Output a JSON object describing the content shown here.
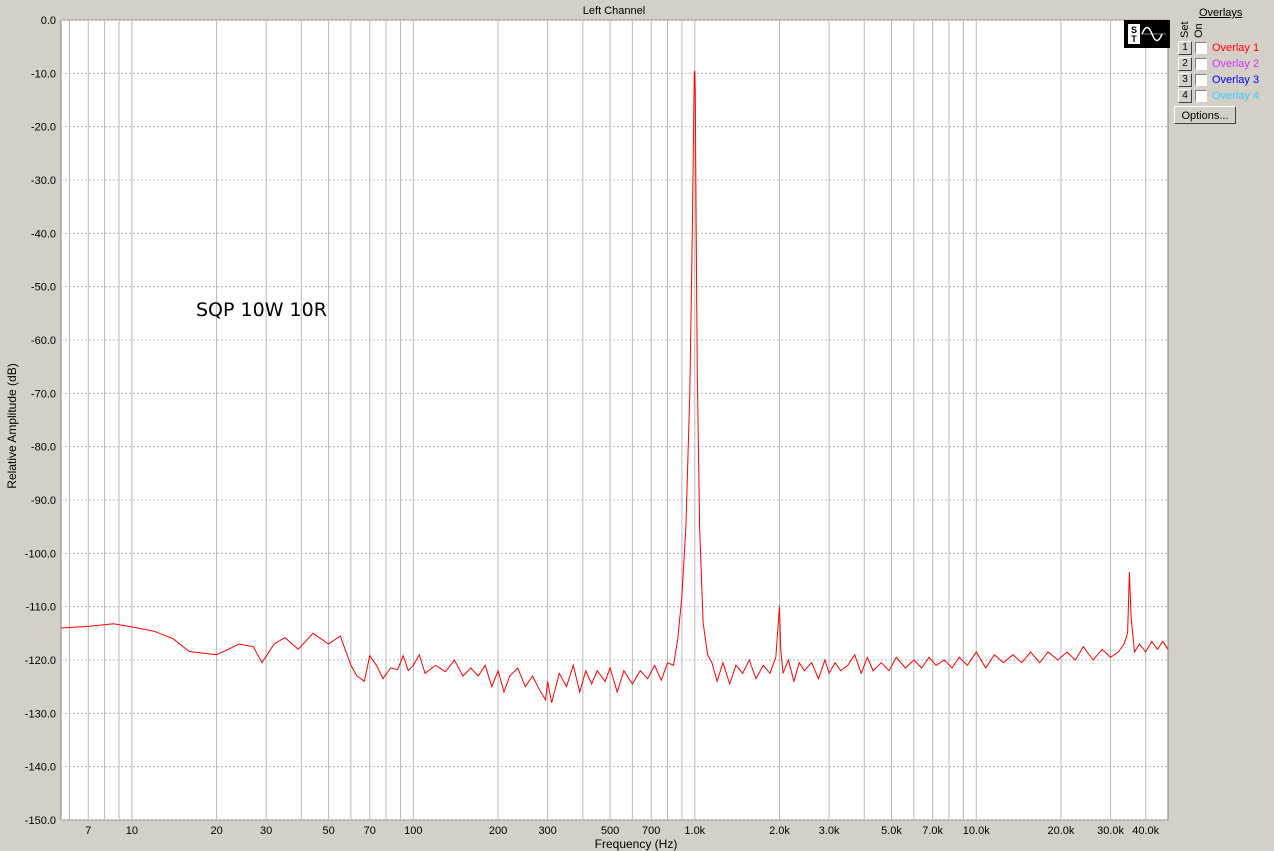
{
  "window": {
    "title": "Left Channel"
  },
  "overlays_panel": {
    "title": "Overlays",
    "set_label": "Set",
    "on_label": "On",
    "items": [
      {
        "number": "1",
        "label": "Overlay 1",
        "color": "#ff0000",
        "checked": false
      },
      {
        "number": "2",
        "label": "Overlay 2",
        "color": "#cc33ff",
        "checked": false
      },
      {
        "number": "3",
        "label": "Overlay 3",
        "color": "#0000ff",
        "checked": false
      },
      {
        "number": "4",
        "label": "Overlay 4",
        "color": "#33ccff",
        "checked": false
      }
    ],
    "options_label": "Options..."
  },
  "logo_icon": "sine-wave-logo-icon",
  "chart_data": {
    "type": "line",
    "title": "Left Channel",
    "xlabel": "Frequency (Hz)",
    "ylabel": "Relative Amplitude (dB)",
    "x_scale": "log",
    "xlim": [
      5.6,
      48000
    ],
    "ylim": [
      -150,
      0
    ],
    "grid": true,
    "annotation": "SQP 10W 10R",
    "line_color": "#ff0000",
    "x_ticks": [
      {
        "value": 7,
        "label": "7"
      },
      {
        "value": 10,
        "label": "10"
      },
      {
        "value": 20,
        "label": "20"
      },
      {
        "value": 30,
        "label": "30"
      },
      {
        "value": 50,
        "label": "50"
      },
      {
        "value": 70,
        "label": "70"
      },
      {
        "value": 100,
        "label": "100"
      },
      {
        "value": 200,
        "label": "200"
      },
      {
        "value": 300,
        "label": "300"
      },
      {
        "value": 500,
        "label": "500"
      },
      {
        "value": 700,
        "label": "700"
      },
      {
        "value": 1000,
        "label": "1.0k"
      },
      {
        "value": 2000,
        "label": "2.0k"
      },
      {
        "value": 3000,
        "label": "3.0k"
      },
      {
        "value": 5000,
        "label": "5.0k"
      },
      {
        "value": 7000,
        "label": "7.0k"
      },
      {
        "value": 10000,
        "label": "10.0k"
      },
      {
        "value": 20000,
        "label": "20.0k"
      },
      {
        "value": 30000,
        "label": "30.0k"
      },
      {
        "value": 40000,
        "label": "40.0k"
      }
    ],
    "y_ticks": [
      {
        "value": 0,
        "label": "0.0"
      },
      {
        "value": -10,
        "label": "-10.0"
      },
      {
        "value": -20,
        "label": "-20.0"
      },
      {
        "value": -30,
        "label": "-30.0"
      },
      {
        "value": -40,
        "label": "-40.0"
      },
      {
        "value": -50,
        "label": "-50.0"
      },
      {
        "value": -60,
        "label": "-60.0"
      },
      {
        "value": -70,
        "label": "-70.0"
      },
      {
        "value": -80,
        "label": "-80.0"
      },
      {
        "value": -90,
        "label": "-90.0"
      },
      {
        "value": -100,
        "label": "-100.0"
      },
      {
        "value": -110,
        "label": "-110.0"
      },
      {
        "value": -120,
        "label": "-120.0"
      },
      {
        "value": -130,
        "label": "-130.0"
      },
      {
        "value": -140,
        "label": "-140.0"
      },
      {
        "value": -150,
        "label": "-150.0"
      }
    ],
    "series": [
      {
        "color": "#ff0000",
        "x": [
          5.6,
          7.0,
          8.6,
          10.0,
          12.0,
          14.0,
          16.0,
          20.0,
          22.0,
          24.0,
          27.0,
          29.0,
          32.0,
          35.0,
          39.0,
          44.0,
          50.0,
          55.0,
          60.0,
          63.0,
          67.0,
          70.0,
          74.0,
          78.0,
          83.0,
          88.0,
          92.0,
          96.0,
          100.0,
          105.0,
          110.0,
          120.0,
          130.0,
          140.0,
          150.0,
          160.0,
          170.0,
          180.0,
          190.0,
          200.0,
          210.0,
          220.0,
          235.0,
          250.0,
          265.0,
          280.0,
          295.0,
          300.0,
          310.0,
          330.0,
          350.0,
          370.0,
          390.0,
          410.0,
          430.0,
          450.0,
          480.0,
          500.0,
          530.0,
          560.0,
          600.0,
          640.0,
          680.0,
          720.0,
          760.0,
          800.0,
          840.0,
          870.0,
          900.0,
          930.0,
          960.0,
          980.0,
          990.0,
          996.0,
          1000.0,
          1004.0,
          1010.0,
          1020.0,
          1040.0,
          1070.0,
          1110.0,
          1150.0,
          1200.0,
          1260.0,
          1330.0,
          1400.0,
          1480.0,
          1560.0,
          1650.0,
          1750.0,
          1850.0,
          1940.0,
          1980.0,
          2000.0,
          2020.0,
          2060.0,
          2150.0,
          2250.0,
          2350.0,
          2450.0,
          2600.0,
          2750.0,
          2900.0,
          3000.0,
          3150.0,
          3300.0,
          3500.0,
          3700.0,
          3900.0,
          4100.0,
          4300.0,
          4600.0,
          4900.0,
          5200.0,
          5600.0,
          6000.0,
          6400.0,
          6800.0,
          7200.0,
          7700.0,
          8200.0,
          8700.0,
          9300.0,
          10000.0,
          10800.0,
          11600.0,
          12500.0,
          13500.0,
          14500.0,
          15600.0,
          16800.0,
          18000.0,
          19500.0,
          21000.0,
          22500.0,
          24000.0,
          26000.0,
          28000.0,
          30000.0,
          32000.0,
          33500.0,
          34500.0,
          35000.0,
          35500.0,
          36500.0,
          38000.0,
          40000.0,
          42000.0,
          44000.0,
          46000.0,
          48000.0
        ],
        "y": [
          -114.0,
          -113.7,
          -113.2,
          -113.8,
          -114.6,
          -116.0,
          -118.4,
          -119.0,
          -118.0,
          -117.0,
          -117.5,
          -120.5,
          -117.0,
          -115.8,
          -118.0,
          -115.0,
          -117.0,
          -115.5,
          -121.0,
          -123.0,
          -124.0,
          -119.2,
          -121.0,
          -123.5,
          -121.5,
          -121.8,
          -119.2,
          -122.0,
          -121.0,
          -119.0,
          -122.5,
          -121.0,
          -122.2,
          -120.0,
          -123.0,
          -121.5,
          -123.0,
          -121.0,
          -125.0,
          -122.0,
          -126.0,
          -123.0,
          -121.5,
          -125.0,
          -123.0,
          -125.5,
          -127.5,
          -124.0,
          -128.0,
          -122.5,
          -125.0,
          -121.0,
          -126.0,
          -122.0,
          -124.5,
          -122.0,
          -124.0,
          -121.5,
          -126.0,
          -122.0,
          -124.5,
          -122.0,
          -123.5,
          -121.0,
          -123.8,
          -120.5,
          -121.0,
          -116.0,
          -108.0,
          -95.0,
          -70.0,
          -40.0,
          -20.0,
          -10.0,
          -9.5,
          -14.0,
          -35.0,
          -65.0,
          -95.0,
          -113.0,
          -119.0,
          -120.5,
          -124.0,
          -120.5,
          -124.5,
          -121.0,
          -122.5,
          -120.0,
          -123.5,
          -121.0,
          -122.5,
          -119.5,
          -113.0,
          -110.0,
          -118.0,
          -122.5,
          -120.0,
          -124.0,
          -120.5,
          -122.0,
          -120.5,
          -123.5,
          -120.0,
          -122.5,
          -120.5,
          -122.0,
          -121.0,
          -119.0,
          -122.5,
          -119.5,
          -122.0,
          -120.5,
          -122.0,
          -119.5,
          -121.5,
          -120.0,
          -121.5,
          -119.5,
          -121.0,
          -120.0,
          -121.5,
          -119.5,
          -121.0,
          -118.5,
          -121.5,
          -119.0,
          -120.5,
          -119.0,
          -120.5,
          -118.5,
          -120.5,
          -118.5,
          -120.0,
          -118.5,
          -120.0,
          -117.5,
          -120.0,
          -118.0,
          -119.5,
          -118.5,
          -117.0,
          -115.0,
          -103.5,
          -112.0,
          -118.5,
          -117.0,
          -118.5,
          -116.5,
          -118.0,
          -116.5,
          -118.0
        ]
      }
    ]
  }
}
